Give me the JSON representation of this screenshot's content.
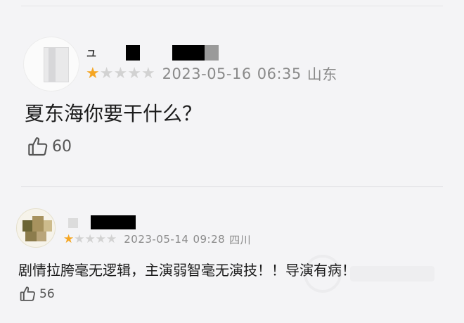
{
  "comments": [
    {
      "date": "2023-05-16",
      "time": "06:35",
      "location": "山东",
      "rating": 1,
      "rating_max": 5,
      "text": "夏东海你要干什么？",
      "likes": "60",
      "name_visible": "ユ"
    },
    {
      "date": "2023-05-14",
      "time": "09:28",
      "location": "四川",
      "rating": 1,
      "rating_max": 5,
      "text": "剧情拉胯毫无逻辑，主演弱智毫无演技！！导演有病！",
      "likes": "56"
    }
  ],
  "icons": {
    "rating": "star-icon",
    "like": "thumbs-up-icon"
  },
  "colors": {
    "star_on": "#f5a623",
    "star_off": "#d2d2d2",
    "meta_text": "#8a8a8a",
    "background": "#f4f4f6"
  }
}
